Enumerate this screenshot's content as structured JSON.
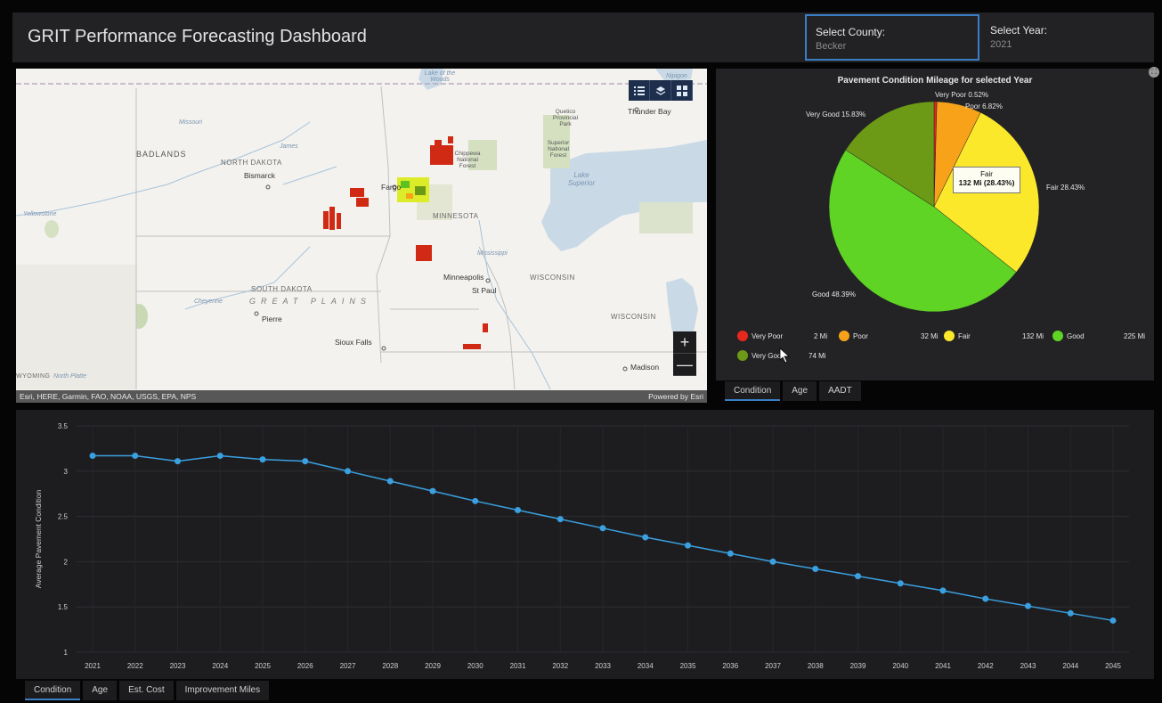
{
  "header": {
    "title": "GRIT Performance Forecasting Dashboard",
    "county_label": "Select County:",
    "county_value": "Becker",
    "year_label": "Select Year:",
    "year_value": "2021"
  },
  "map": {
    "labels": {
      "badlands": "BADLANDS",
      "north_dakota": "NORTH DAKOTA",
      "bismarck": "Bismarck",
      "fargo": "Fargo",
      "minnesota": "MINNESOTA",
      "minneapolis": "Minneapolis",
      "st_paul": "St Paul",
      "wisconsin1": "WISCONSIN",
      "wisconsin2": "WISCONSIN",
      "south_dakota": "SOUTH DAKOTA",
      "great_plains": "GREAT PLAINS",
      "pierre": "Pierre",
      "sioux_falls": "Sioux Falls",
      "madison": "Madison",
      "thunder_bay": "Thunder Bay",
      "lake_superior": "Lake Superior",
      "quetico": "Quetico Provincial Park",
      "superior_nf": "Superior National Forest",
      "chippewa": "Chippewa National Forest",
      "lake_woods": "Lake of the Woods",
      "yellowstone": "Yellowstone",
      "missouri": "Missouri",
      "cheyenne": "Cheyenne",
      "james": "James",
      "mississippi": "Mississippi",
      "north_platte": "North Platte",
      "wyoming": "WYOMING",
      "nipigon": "Nipigon"
    },
    "attribution": "Esri, HERE, Garmin, FAO, NOAA, USGS, EPA, NPS",
    "powered_by": "Powered by Esri",
    "zoom_in": "+",
    "zoom_out": "—"
  },
  "pie": {
    "title": "Pavement Condition Mileage for selected Year",
    "colors": {
      "very_poor": "#e8281c",
      "poor": "#f8a21a",
      "fair": "#fce82a",
      "good": "#5fd424",
      "very_good": "#6c9a16"
    },
    "slice_labels": {
      "very_poor": "Very Poor 0.52%",
      "poor": "Poor 6.82%",
      "fair": "Fair 28.43%",
      "good": "Good 48.39%",
      "very_good": "Very Good 15.83%"
    },
    "tooltip": {
      "name": "Fair",
      "value": "132 Mi (28.43%)"
    },
    "legend": [
      {
        "name": "Very Poor",
        "value": "2 Mi"
      },
      {
        "name": "Poor",
        "value": "32 Mi"
      },
      {
        "name": "Fair",
        "value": "132 Mi"
      },
      {
        "name": "Good",
        "value": "225 Mi"
      },
      {
        "name": "Very Good",
        "value": "74 Mi"
      }
    ]
  },
  "pie_tabs": [
    "Condition",
    "Age",
    "AADT"
  ],
  "bottom_tabs": [
    "Condition",
    "Age",
    "Est. Cost",
    "Improvement Miles"
  ],
  "chart_data": [
    {
      "type": "pie",
      "title": "Pavement Condition Mileage for selected Year",
      "categories": [
        "Very Poor",
        "Poor",
        "Fair",
        "Good",
        "Very Good"
      ],
      "values": [
        2,
        32,
        132,
        225,
        74
      ],
      "percentages": [
        0.52,
        6.82,
        28.43,
        48.39,
        15.83
      ],
      "legend_position": "bottom"
    },
    {
      "type": "line",
      "x": [
        "2021",
        "2022",
        "2023",
        "2024",
        "2025",
        "2026",
        "2027",
        "2028",
        "2029",
        "2030",
        "2031",
        "2032",
        "2033",
        "2034",
        "2035",
        "2036",
        "2037",
        "2038",
        "2039",
        "2040",
        "2041",
        "2042",
        "2043",
        "2044",
        "2045"
      ],
      "series": [
        {
          "values": [
            3.17,
            3.17,
            3.11,
            3.17,
            3.13,
            3.11,
            3.0,
            2.89,
            2.78,
            2.67,
            2.57,
            2.47,
            2.37,
            2.27,
            2.18,
            2.09,
            2.0,
            1.92,
            1.84,
            1.76,
            1.68,
            1.59,
            1.51,
            1.43,
            1.35
          ]
        }
      ],
      "ylabel": "Average Pavement Condition",
      "xlabel": "",
      "ylim": [
        1,
        3.5
      ],
      "yticks": [
        "1",
        "1.5",
        "2",
        "2.5",
        "3",
        "3.5"
      ],
      "grid": true,
      "line_color": "#3aa0e0"
    }
  ]
}
